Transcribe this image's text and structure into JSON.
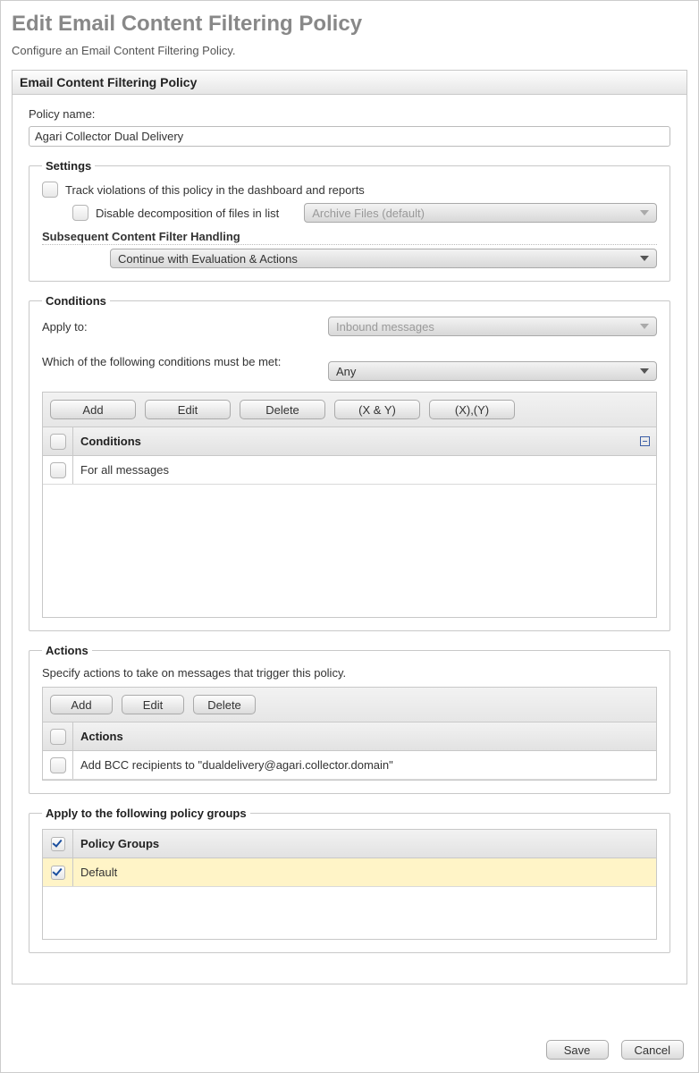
{
  "page": {
    "title": "Edit Email Content Filtering Policy",
    "subtitle": "Configure an Email Content Filtering Policy."
  },
  "panel": {
    "title": "Email Content Filtering Policy"
  },
  "policy_name": {
    "label": "Policy name:",
    "value": "Agari Collector Dual Delivery"
  },
  "settings": {
    "legend": "Settings",
    "track_label": "Track violations of this policy in the dashboard and reports",
    "track_checked": false,
    "disable_decomp_label": "Disable decomposition of files in list",
    "disable_decomp_checked": false,
    "archive_files_dropdown": "Archive Files (default)",
    "subseq_heading": "Subsequent Content Filter Handling",
    "subseq_dropdown": "Continue with Evaluation & Actions"
  },
  "conditions": {
    "legend": "Conditions",
    "apply_to_label": "Apply to:",
    "apply_to_value": "Inbound messages",
    "which_label": "Which of the following conditions must be met:",
    "which_value": "Any",
    "buttons": {
      "add": "Add",
      "edit": "Edit",
      "delete": "Delete",
      "xy": "(X & Y)",
      "x_y": "(X),(Y)"
    },
    "grid": {
      "header": "Conditions",
      "rows": [
        {
          "text": "For all messages",
          "checked": false
        }
      ]
    }
  },
  "actions": {
    "legend": "Actions",
    "description": "Specify actions to take on messages that trigger this policy.",
    "buttons": {
      "add": "Add",
      "edit": "Edit",
      "delete": "Delete"
    },
    "grid": {
      "header": "Actions",
      "rows": [
        {
          "text": "Add BCC recipients to \"dualdelivery@agari.collector.domain\"",
          "checked": false
        }
      ]
    }
  },
  "policy_groups": {
    "legend": "Apply to the following policy groups",
    "grid": {
      "header": "Policy Groups",
      "header_checked": true,
      "rows": [
        {
          "text": "Default",
          "checked": true,
          "selected": true
        }
      ]
    }
  },
  "footer": {
    "save": "Save",
    "cancel": "Cancel"
  }
}
